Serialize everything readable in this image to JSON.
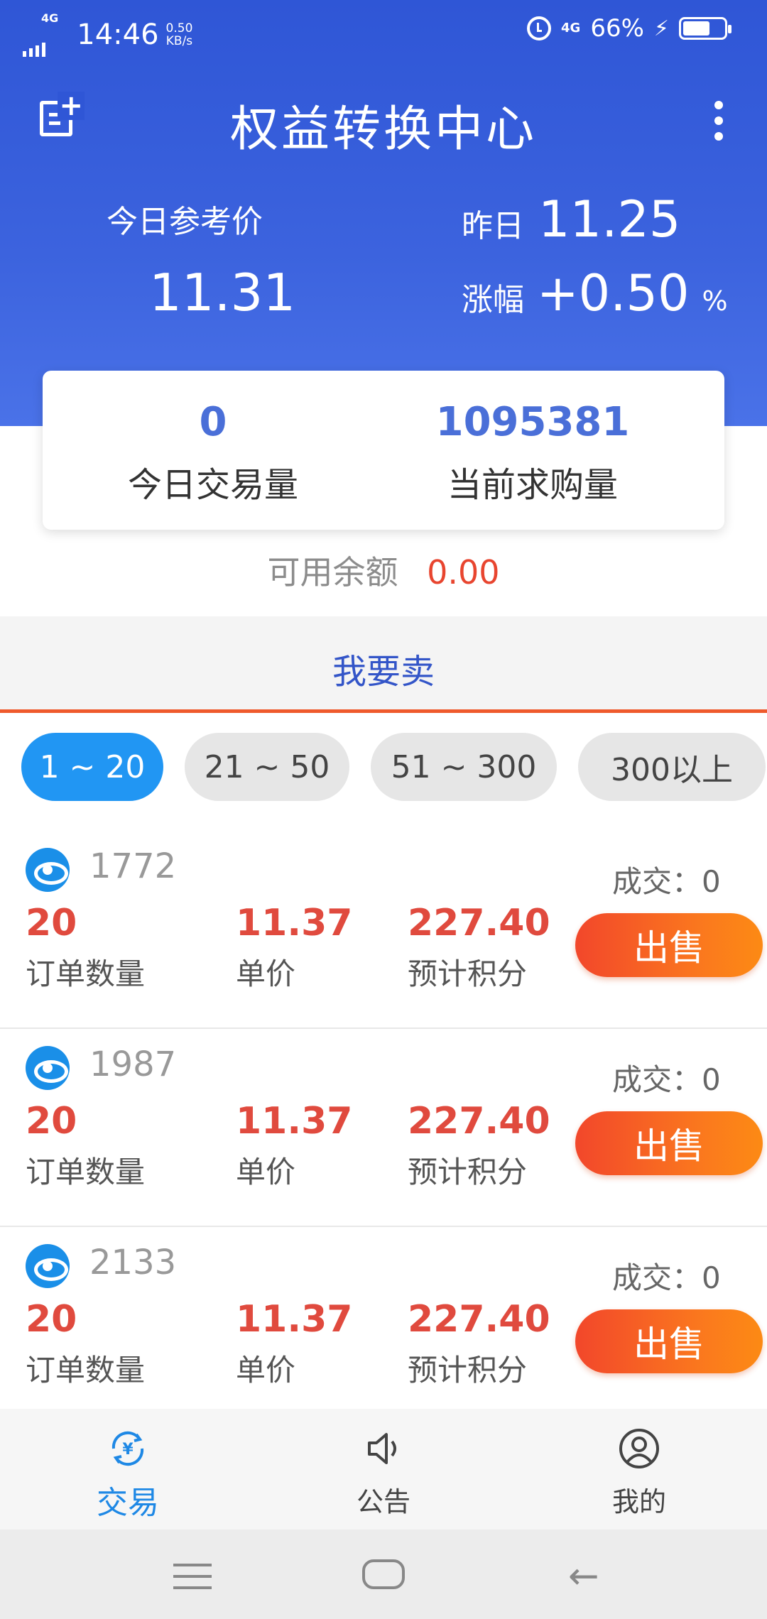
{
  "status_bar": {
    "network": "4G",
    "time": "14:46",
    "speed_value": "0.50",
    "speed_unit": "KB/s",
    "network_right": "4G",
    "battery": "66%"
  },
  "app_bar": {
    "title": "权益转换中心"
  },
  "prices": {
    "today_label": "今日参考价",
    "today_value": "11.31",
    "yesterday_label": "昨日",
    "yesterday_value": "11.25",
    "change_label": "涨幅",
    "change_value": "+0.50",
    "change_unit": "%"
  },
  "volume": {
    "today_volume_value": "0",
    "today_volume_label": "今日交易量",
    "buy_volume_value": "1095381",
    "buy_volume_label": "当前求购量"
  },
  "balance": {
    "label": "可用余额",
    "value": "0.00"
  },
  "tab": {
    "label": "我要卖"
  },
  "ranges": [
    "1 ~ 20",
    "21 ~ 50",
    "51 ~ 300",
    "300以上"
  ],
  "orders": [
    {
      "id": "1772",
      "deal": "成交：0",
      "qty": "20",
      "qty_label": "订单数量",
      "price": "11.37",
      "price_label": "单价",
      "points": "227.40",
      "points_label": "预计积分",
      "button": "出售"
    },
    {
      "id": "1987",
      "deal": "成交：0",
      "qty": "20",
      "qty_label": "订单数量",
      "price": "11.37",
      "price_label": "单价",
      "points": "227.40",
      "points_label": "预计积分",
      "button": "出售"
    },
    {
      "id": "2133",
      "deal": "成交：0",
      "qty": "20",
      "qty_label": "订单数量",
      "price": "11.37",
      "price_label": "单价",
      "points": "227.40",
      "points_label": "预计积分",
      "button": "出售"
    }
  ],
  "bottom_nav": {
    "items": [
      {
        "label": "交易",
        "icon": "yen-exchange-icon",
        "active": true
      },
      {
        "label": "公告",
        "icon": "speaker-icon",
        "active": false
      },
      {
        "label": "我的",
        "icon": "user-icon",
        "active": false
      }
    ]
  },
  "colors": {
    "header_blue": "#2f56d6",
    "accent_red": "#e04a3e",
    "active_chip": "#2196f3",
    "sell_button": "#f2472b"
  }
}
